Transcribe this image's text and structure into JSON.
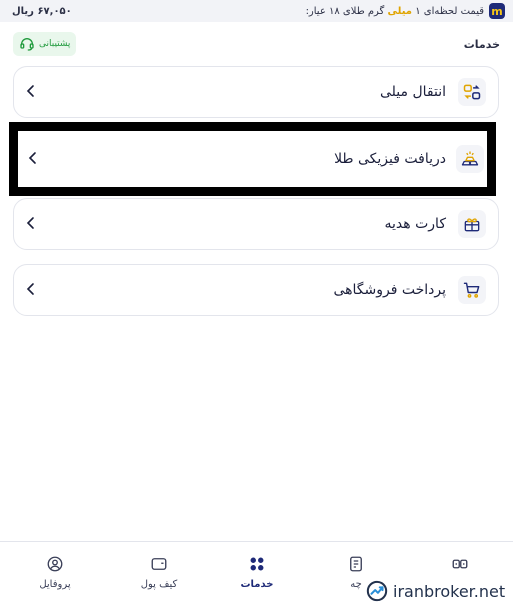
{
  "topbar": {
    "price_prefix": "قیمت لحظه‌ای ۱",
    "price_unit": "میلی",
    "price_suffix": "گرم طلای ۱۸ عیار:",
    "price_value": "۶۷,۰۵۰ ریال"
  },
  "header": {
    "title": "خدمات",
    "support_label": "پشتیبانی"
  },
  "services": [
    {
      "label": "انتقال میلی",
      "icon": "transfer-icon"
    },
    {
      "label": "دریافت فیزیکی طلا",
      "icon": "gold-bars-icon"
    },
    {
      "label": "کارت هدیه",
      "icon": "gift-card-icon"
    },
    {
      "label": "پرداخت فروشگاهی",
      "icon": "cart-icon"
    }
  ],
  "nav": {
    "profile": "پروفایل",
    "wallet": "کیف پول",
    "services": "خدمات",
    "orders": "چه",
    "market": ""
  },
  "watermark": "iranbroker.net",
  "colors": {
    "brand_navy": "#1e2a78",
    "accent_gold": "#e0a400",
    "support_green": "#1f9a3c"
  }
}
